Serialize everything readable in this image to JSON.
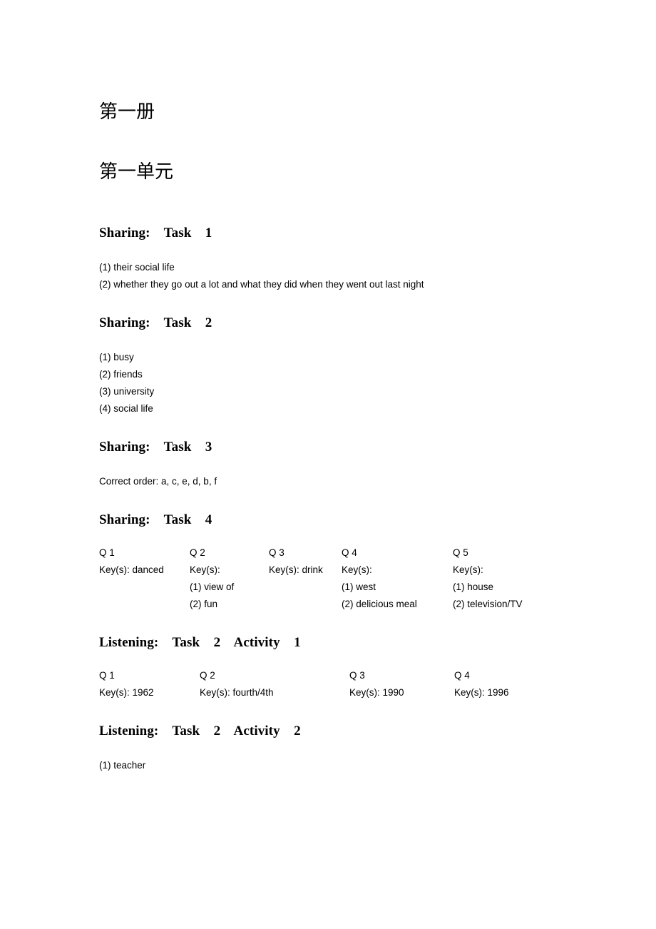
{
  "document": {
    "volume_title": "第一册",
    "unit_title": "第一单元"
  },
  "sections": {
    "sharing_task_1": {
      "heading": "Sharing:    Task    1",
      "answers": [
        "(1) their social life",
        "(2) whether they go out a lot and what they did when they went out last night"
      ]
    },
    "sharing_task_2": {
      "heading": "Sharing:    Task    2",
      "answers": [
        "(1) busy",
        "(2) friends",
        "(3) university",
        "(4) social life"
      ]
    },
    "sharing_task_3": {
      "heading": "Sharing:    Task    3",
      "answers": [
        "Correct order: a, c, e, d, b, f"
      ]
    },
    "sharing_task_4": {
      "heading": "Sharing:    Task    4",
      "questions": [
        {
          "label": "Q 1",
          "lines": [
            "Key(s): danced"
          ]
        },
        {
          "label": "Q 2",
          "lines": [
            "Key(s):",
            "(1) view of",
            "(2) fun"
          ]
        },
        {
          "label": "Q 3",
          "lines": [
            "Key(s): drink"
          ]
        },
        {
          "label": "Q 4",
          "lines": [
            "Key(s):",
            "(1) west",
            "(2) delicious meal"
          ]
        },
        {
          "label": "Q 5",
          "lines": [
            "Key(s):",
            "(1) house",
            "(2) television/TV"
          ]
        }
      ]
    },
    "listening_task_2_activity_1": {
      "heading": "Listening:    Task    2    Activity    1",
      "questions": [
        {
          "label": "Q 1",
          "lines": [
            "Key(s): 1962"
          ]
        },
        {
          "label": "Q 2",
          "lines": [
            "Key(s): fourth/4th"
          ]
        },
        {
          "label": "Q 3",
          "lines": [
            "Key(s): 1990"
          ]
        },
        {
          "label": "Q 4",
          "lines": [
            "Key(s): 1996"
          ]
        }
      ]
    },
    "listening_task_2_activity_2": {
      "heading": "Listening:    Task    2    Activity    2",
      "answers": [
        "(1) teacher"
      ]
    }
  }
}
